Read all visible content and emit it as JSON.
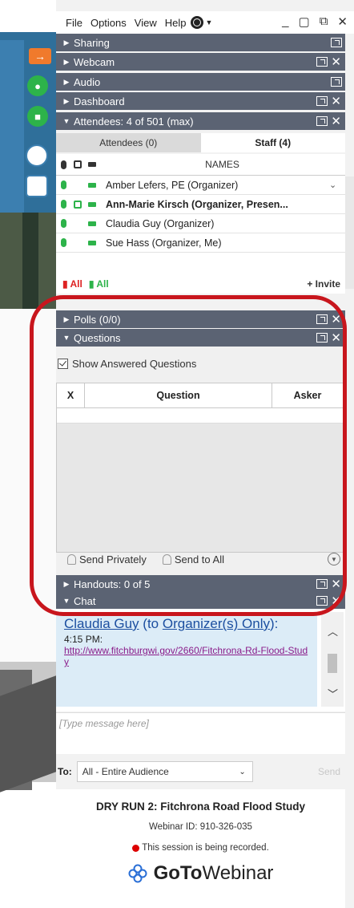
{
  "menu": {
    "items": [
      "File",
      "Options",
      "View",
      "Help"
    ]
  },
  "window_controls": {
    "minimize": "_",
    "restore": "▢",
    "pin": "⧉",
    "close": "✕"
  },
  "panes": {
    "sharing": "Sharing",
    "webcam": "Webcam",
    "audio": "Audio",
    "dashboard": "Dashboard",
    "attendees": "Attendees: 4 of 501 (max)",
    "polls": "Polls (0/0)",
    "questions": "Questions",
    "handouts": "Handouts: 0 of 5",
    "chat": "Chat"
  },
  "attendees": {
    "tabs": [
      "Attendees (0)",
      "Staff (4)"
    ],
    "names_header": "NAMES",
    "rows": [
      {
        "name": "Amber Lefers, PE (Organizer)",
        "bold": false
      },
      {
        "name": "Ann-Marie Kirsch (Organizer, Presen...",
        "bold": true
      },
      {
        "name": "Claudia Guy (Organizer)",
        "bold": false
      },
      {
        "name": "Sue Hass (Organizer, Me)",
        "bold": false
      }
    ],
    "footer": {
      "all_red": "All",
      "all_green": "All",
      "invite": "Invite"
    }
  },
  "questions": {
    "show_answered": "Show Answered Questions",
    "columns": [
      "X",
      "Question",
      "Asker"
    ],
    "send_privately": "Send Privately",
    "send_to_all": "Send to All"
  },
  "chat": {
    "from_name": "Claudia Guy",
    "from_middle": " (to ",
    "from_to": "Organizer(s) Only",
    "from_end": "):",
    "time": "4:15 PM:",
    "url": "http://www.fitchburgwi.gov/2660/Fitchrona-Rd-Flood-Study",
    "input_placeholder": "[Type message here]",
    "to_label": "To:",
    "to_value": "All - Entire Audience",
    "send_label": "Send"
  },
  "footer": {
    "title": "DRY RUN 2:  Fitchrona Road Flood Study",
    "webinar_id": "Webinar ID: 910-326-035",
    "recording": "This session is being recorded.",
    "brand_bold": "GoTo",
    "brand_rest": "Webinar"
  },
  "colors": {
    "header_bg": "#5b6373",
    "accent_green": "#2db34a",
    "highlight_red": "#c8161d",
    "link_blue": "#1c4fa0"
  }
}
